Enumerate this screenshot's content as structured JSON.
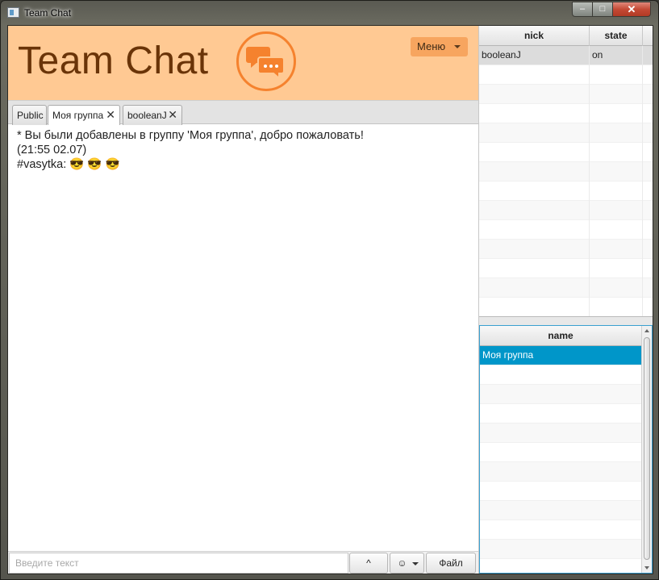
{
  "window": {
    "title": "Team Chat",
    "controls": {
      "minimize": "‒",
      "maximize": "□",
      "close": "✕"
    }
  },
  "header": {
    "logo_text": "Team Chat",
    "logo_icon": "chat-bubbles-icon",
    "menu_label": "Меню",
    "colors": {
      "banner": "#ffc993",
      "accent": "#f5822e",
      "logo_text": "#6a3408"
    }
  },
  "tabs": [
    {
      "label": "Public",
      "closable": false,
      "active": false
    },
    {
      "label": "Моя группа",
      "closable": true,
      "active": true
    },
    {
      "label": "booleanJ",
      "closable": true,
      "active": false
    }
  ],
  "messages": [
    "* Вы были добавлены в группу 'Моя группа', добро пожаловать!",
    "(21:55 02.07)",
    "#vasytka: 😎 😎 😎"
  ],
  "input": {
    "placeholder": "Введите текст",
    "send_up_label": "^",
    "emoji_label": "☺",
    "file_label": "Файл"
  },
  "users_table": {
    "columns": [
      "nick",
      "state"
    ],
    "rows": [
      {
        "nick": "booleanJ",
        "state": "on"
      }
    ]
  },
  "groups_table": {
    "columns": [
      "name"
    ],
    "rows": [
      {
        "name": "Моя группа"
      }
    ],
    "selected_color": "#0096c9"
  }
}
